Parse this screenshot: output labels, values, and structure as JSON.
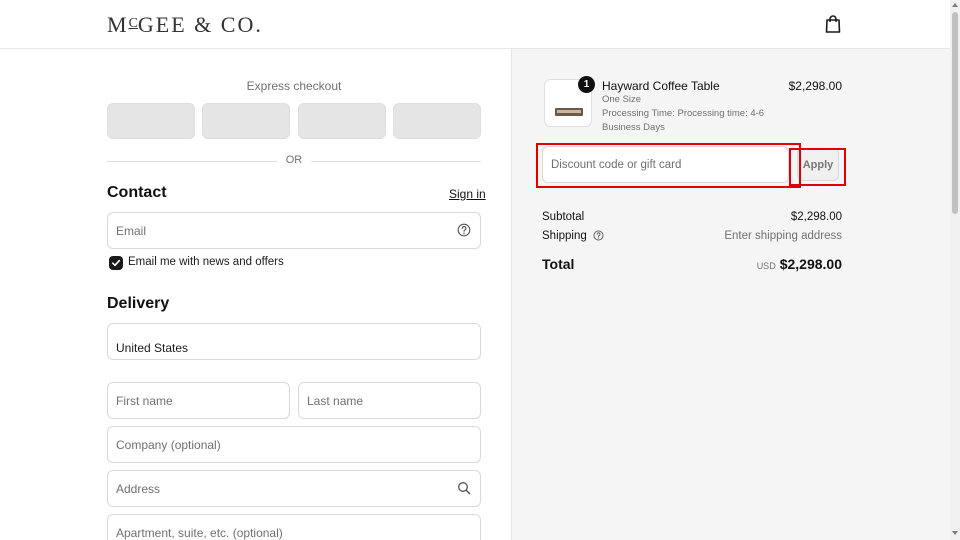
{
  "header": {
    "logo_text": "MCGEE & CO.",
    "logo_prefix": "M",
    "logo_small": "C",
    "logo_rest": "GEE & CO.",
    "cart_icon": "shopping-bag-icon"
  },
  "express": {
    "label": "Express checkout",
    "button_count": 4,
    "or_text": "OR"
  },
  "contact": {
    "title": "Contact",
    "sign_in": "Sign in",
    "email_placeholder": "Email",
    "email_help_icon": "question-circle-icon",
    "newsletter_label": "Email me with news and offers",
    "newsletter_checked": true
  },
  "delivery": {
    "title": "Delivery",
    "country": "United States",
    "first_name_placeholder": "First name",
    "last_name_placeholder": "Last name",
    "company_placeholder": "Company (optional)",
    "address_placeholder": "Address",
    "address_icon": "search-icon",
    "apartment_placeholder": "Apartment, suite, etc. (optional)"
  },
  "summary": {
    "product": {
      "quantity": "1",
      "name": "Hayward Coffee Table",
      "variant": "One Size",
      "processing_line1": "Processing Time: Processing time: 4-6",
      "processing_line2": "Business Days",
      "price": "$2,298.00"
    },
    "discount_placeholder": "Discount code or gift card",
    "apply_label": "Apply",
    "subtotal_label": "Subtotal",
    "subtotal_value": "$2,298.00",
    "shipping_label": "Shipping",
    "shipping_value": "Enter shipping address",
    "total_label": "Total",
    "total_currency": "USD",
    "total_value": "$2,298.00"
  },
  "colors": {
    "highlight": "#e00000",
    "panel_bg": "#f5f5f5",
    "accent": "#1a1a1a"
  }
}
